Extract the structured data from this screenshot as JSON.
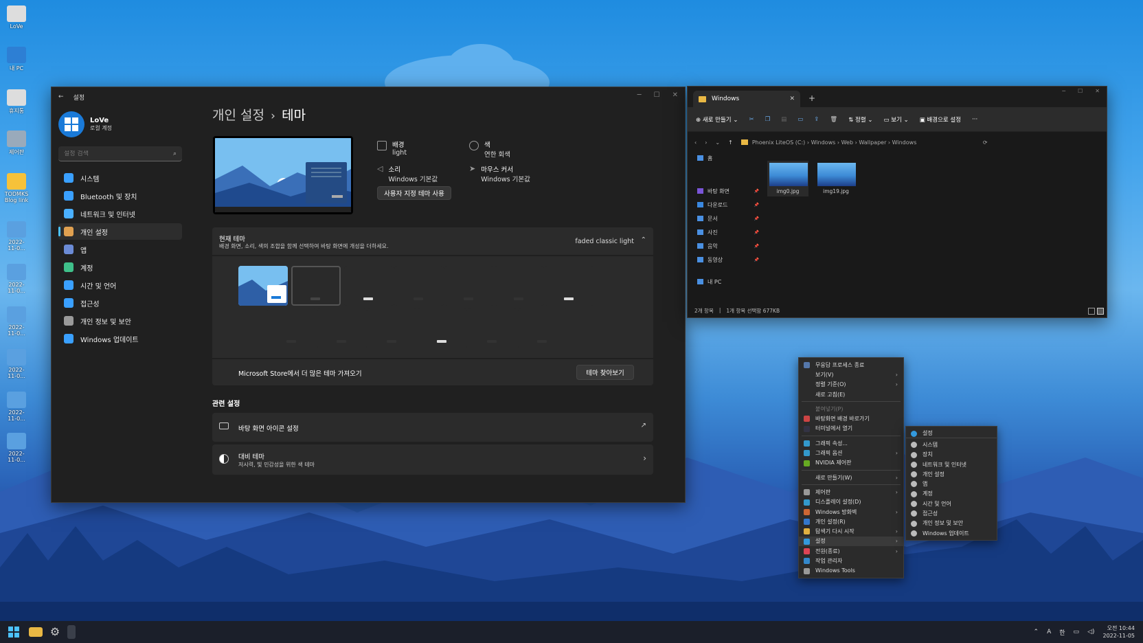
{
  "desktop": {
    "icons": [
      "LoVe",
      "내 PC",
      "휴지통",
      "제어판",
      "TODMKS Blog link",
      "2022-11-0...",
      "2022-11-0...",
      "2022-11-0...",
      "2022-11-0...",
      "2022-11-0...",
      "2022-11-0..."
    ]
  },
  "settings": {
    "window_title": "설정",
    "user": {
      "name": "LoVe",
      "account": "로컬 계정"
    },
    "search_placeholder": "설정 검색",
    "nav": [
      {
        "label": "시스템",
        "color": "#3aa0ff"
      },
      {
        "label": "Bluetooth 및 장치",
        "color": "#3aa0ff"
      },
      {
        "label": "네트워크 및 인터넷",
        "color": "#4ab0ff"
      },
      {
        "label": "개인 설정",
        "color": "#e0a050"
      },
      {
        "label": "앱",
        "color": "#6b8bd6"
      },
      {
        "label": "계정",
        "color": "#3fc08a"
      },
      {
        "label": "시간 및 언어",
        "color": "#3aa0ff"
      },
      {
        "label": "접근성",
        "color": "#3aa0ff"
      },
      {
        "label": "개인 정보 및 보안",
        "color": "#9a9a9a"
      },
      {
        "label": "Windows 업데이트",
        "color": "#3aa0ff"
      }
    ],
    "breadcrumb": {
      "parent": "개인 설정",
      "sep": "›",
      "current": "테마"
    },
    "props": {
      "background_label": "배경",
      "background_value": "light",
      "color_label": "색",
      "color_value": "연한 회색",
      "sound_label": "소리",
      "sound_value": "Windows 기본값",
      "cursor_label": "마우스 커서",
      "cursor_value": "Windows 기본값"
    },
    "custom_theme_button": "사용자 지정 테마 사용",
    "current_theme": {
      "title": "현재 테마",
      "desc": "배경 화면, 소리, 색의 조합을 함께 선택하여 바탕 화면에 개성을 더하세요.",
      "value": "faded classic light"
    },
    "store": {
      "text": "Microsoft Store에서 더 많은 테마 가져오기",
      "button": "테마 찾아보기"
    },
    "related": {
      "heading": "관련 설정",
      "desktop_icons": "바탕 화면 아이콘 설정",
      "contrast_title": "대비 테마",
      "contrast_desc": "저시력, 빛 민감성을 위한 색 테마"
    }
  },
  "explorer": {
    "tab": "Windows",
    "toolbar": {
      "new": "새로 만들기",
      "sort": "정렬",
      "view": "보기",
      "set_bg": "배경으로 설정"
    },
    "path": [
      "Phoenix LiteOS (C:)",
      "Windows",
      "Web",
      "Wallpaper",
      "Windows"
    ],
    "sidebar": [
      "홈",
      "바탕 화면",
      "다운로드",
      "문서",
      "사진",
      "음악",
      "동영상",
      "내 PC"
    ],
    "files": [
      "img0.jpg",
      "img19.jpg"
    ],
    "status": {
      "count": "2개 항목",
      "selected": "1개 항목 선택함 677KB"
    }
  },
  "context_menu": {
    "items": [
      {
        "label": "무응답 프로세스 종료",
        "color": "#5577aa"
      },
      {
        "label": "보기(V)",
        "arrow": true
      },
      {
        "label": "정렬 기준(O)",
        "arrow": true
      },
      {
        "label": "새로 고침(E)"
      },
      {
        "sep": true
      },
      {
        "label": "붙여넣기(P)",
        "disabled": true
      },
      {
        "label": "바탕화면 배경 바로가기",
        "color": "#cc4444"
      },
      {
        "label": "터미널에서 열기",
        "color": "#333344"
      },
      {
        "sep": true
      },
      {
        "label": "그래픽 속성...",
        "color": "#3399cc"
      },
      {
        "label": "그래픽 옵션",
        "color": "#3399cc",
        "arrow": true
      },
      {
        "label": "NVIDIA 제어판",
        "color": "#66aa22"
      },
      {
        "sep": true
      },
      {
        "label": "새로 만들기(W)",
        "arrow": true
      },
      {
        "sep": true
      },
      {
        "label": "제어판",
        "color": "#999999",
        "arrow": true
      },
      {
        "label": "디스플레이 설정(D)",
        "color": "#3399cc"
      },
      {
        "label": "Windows 방화벽",
        "color": "#cc6633",
        "arrow": true
      },
      {
        "label": "개인 설정(R)",
        "color": "#3377cc"
      },
      {
        "label": "탐색기 다시 시작",
        "color": "#e0b040",
        "arrow": true
      },
      {
        "label": "설정",
        "color": "#3399dd",
        "arrow": true,
        "active": true
      },
      {
        "label": "전원(종료)",
        "color": "#dd4455",
        "arrow": true
      },
      {
        "label": "작업 관리자",
        "color": "#3388cc"
      },
      {
        "label": "Windows Tools",
        "color": "#999999"
      }
    ],
    "submenu": [
      "설정",
      "시스템",
      "장치",
      "네트워크 및 인터넷",
      "개인 설정",
      "앱",
      "계정",
      "시간 및 언어",
      "접근성",
      "개인 정보 및 보안",
      "Windows 업데이트"
    ]
  },
  "taskbar": {
    "time": "오전 10:44",
    "date": "2022-11-05",
    "ime1": "A",
    "ime2": "한"
  }
}
